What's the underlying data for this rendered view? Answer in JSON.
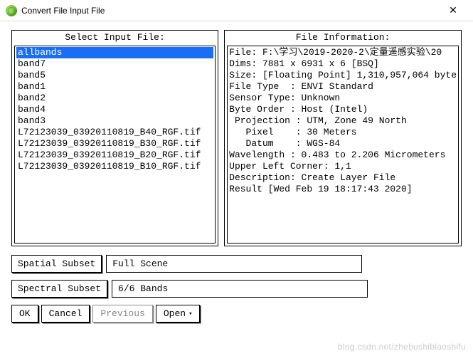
{
  "window": {
    "title": "Convert File Input File",
    "close": "✕"
  },
  "left_panel": {
    "title": "Select Input File:",
    "items": [
      "allbands",
      "band7",
      "band5",
      "band1",
      "band2",
      "band4",
      "band3",
      "L72123039_03920110819_B40_RGF.tif",
      "L72123039_03920110819_B30_RGF.tif",
      "L72123039_03920110819_B20_RGF.tif",
      "L72123039_03920110819_B10_RGF.tif"
    ],
    "selected_index": 0
  },
  "right_panel": {
    "title": "File Information:",
    "lines": [
      "File: F:\\学习\\2019-2020-2\\定量遥感实验\\20",
      "Dims: 7881 x 6931 x 6 [BSQ]",
      "Size: [Floating Point] 1,310,957,064 byte",
      "File Type  : ENVI Standard",
      "Sensor Type: Unknown",
      "Byte Order : Host (Intel)",
      " Projection : UTM, Zone 49 North",
      "   Pixel    : 30 Meters",
      "   Datum    : WGS-84",
      "Wavelength : 0.483 to 2.206 Micrometers",
      "Upper Left Corner: 1,1",
      "Description: Create Layer File",
      "Result [Wed Feb 19 18:17:43 2020]"
    ]
  },
  "spatial": {
    "label": "Spatial Subset",
    "value": "Full Scene"
  },
  "spectral": {
    "label": "Spectral Subset",
    "value": "6/6 Bands"
  },
  "buttons": {
    "ok": "OK",
    "cancel": "Cancel",
    "previous": "Previous",
    "open": "Open",
    "open_arrow": "▾"
  },
  "watermark": "blog.csdn.net/zhebushibiaoshifu"
}
